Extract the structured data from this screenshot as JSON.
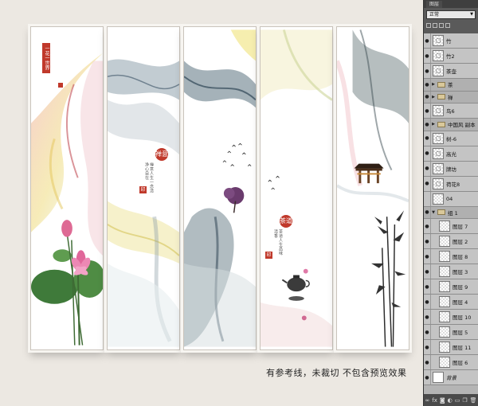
{
  "canvas": {
    "caption": "有参考线，未裁切 不包含预览效果",
    "panel2": {
      "round_title": "禅意",
      "seal": "印"
    },
    "panel4": {
      "round_title": "茶道",
      "seal": "印"
    },
    "panel1": {
      "seal_text": "一花一世界"
    }
  },
  "colors": {
    "seal_red": "#c0392b",
    "panel_bg": "#ffffff",
    "page_bg": "#ece8e2"
  },
  "layers_panel": {
    "tab": "图层",
    "blend_mode": "正常",
    "layers": [
      {
        "name": "竹",
        "kind": "layer",
        "icon": "smart-object-icon"
      },
      {
        "name": "竹2",
        "kind": "layer",
        "icon": "smart-object-icon"
      },
      {
        "name": "茶壶",
        "kind": "layer",
        "icon": "smart-object-icon"
      },
      {
        "name": "茶",
        "kind": "group"
      },
      {
        "name": "禅",
        "kind": "group"
      },
      {
        "name": "鸟6",
        "kind": "layer",
        "icon": "smart-object-icon"
      },
      {
        "name": "中国风 副本",
        "kind": "group"
      },
      {
        "name": "树-6",
        "kind": "layer",
        "icon": "smart-object-icon"
      },
      {
        "name": "高光",
        "kind": "layer",
        "icon": "smart-object-icon"
      },
      {
        "name": "牌坊",
        "kind": "layer",
        "icon": "smart-object-icon"
      },
      {
        "name": "荷花8",
        "kind": "layer",
        "icon": "smart-object-icon"
      },
      {
        "name": "04",
        "kind": "layer",
        "icon": "none"
      },
      {
        "name": "组 1",
        "kind": "group-open"
      },
      {
        "name": "图层 7",
        "kind": "sublayer"
      },
      {
        "name": "图层 2",
        "kind": "sublayer"
      },
      {
        "name": "图层 8",
        "kind": "sublayer"
      },
      {
        "name": "图层 3",
        "kind": "sublayer"
      },
      {
        "name": "图层 9",
        "kind": "sublayer"
      },
      {
        "name": "图层 4",
        "kind": "sublayer"
      },
      {
        "name": "图层 10",
        "kind": "sublayer"
      },
      {
        "name": "图层 5",
        "kind": "sublayer"
      },
      {
        "name": "图层 11",
        "kind": "sublayer"
      },
      {
        "name": "图层 6",
        "kind": "sublayer"
      },
      {
        "name": "背景",
        "kind": "background"
      }
    ],
    "bottom_icons": [
      "link-icon",
      "fx-icon",
      "mask-icon",
      "adjustment-icon",
      "folder-icon",
      "new-layer-icon",
      "trash-icon"
    ]
  }
}
